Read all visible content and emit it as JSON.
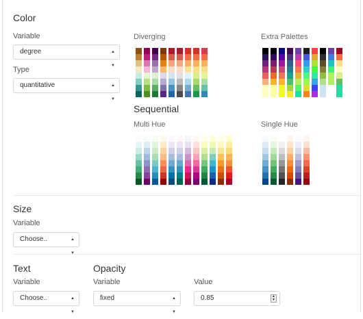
{
  "color": {
    "title": "Color",
    "variable_label": "Variable",
    "variable_value": "degree",
    "type_label": "Type",
    "type_value": "quantitative",
    "diverging_label": "Diverging",
    "extra_label": "Extra Palettes",
    "sequential_label": "Sequential",
    "multi_hue_label": "Multi Hue",
    "single_hue_label": "Single Hue"
  },
  "palettes": {
    "diverging": [
      [
        "#8c510a",
        "#bf812d",
        "#dfc27d",
        "#f6e8c3",
        "#c7eae5",
        "#80cdc1",
        "#35978f",
        "#01665e"
      ],
      [
        "#8e0152",
        "#c51b7d",
        "#de77ae",
        "#f1b6da",
        "#e6f5d0",
        "#b8e186",
        "#7fbc41",
        "#4d9221"
      ],
      [
        "#40004b",
        "#762a83",
        "#9970ab",
        "#c2a5cf",
        "#d9f0d3",
        "#a6dba0",
        "#5aae61",
        "#1b7837"
      ],
      [
        "#7f3b08",
        "#b35806",
        "#e08214",
        "#fdb863",
        "#d8daeb",
        "#b2abd2",
        "#8073ac",
        "#542788"
      ],
      [
        "#b2182b",
        "#d6604d",
        "#f4a582",
        "#fddbc7",
        "#d1e5f0",
        "#92c5de",
        "#4393c3",
        "#2166ac"
      ],
      [
        "#b2182b",
        "#d6604d",
        "#f4a582",
        "#fddbc7",
        "#e0e0e0",
        "#bababa",
        "#878787",
        "#4d4d4d"
      ],
      [
        "#d73027",
        "#f46d43",
        "#fdae61",
        "#fee090",
        "#e0f3f8",
        "#abd9e9",
        "#74add1",
        "#4575b4"
      ],
      [
        "#d73027",
        "#f46d43",
        "#fdae61",
        "#fee08b",
        "#d9ef8b",
        "#a6d96a",
        "#66bd63",
        "#1a9850"
      ],
      [
        "#d53e4f",
        "#f46d43",
        "#fdae61",
        "#fee08b",
        "#e6f598",
        "#abdda4",
        "#66c2a5",
        "#3288bd"
      ]
    ],
    "extra": [
      [
        "#000004",
        "#2c105c",
        "#711f81",
        "#b63679",
        "#ee605e",
        "#fdae78",
        "#fcfdbf",
        "#fcfdbf"
      ],
      [
        "#000004",
        "#320a5e",
        "#781c6d",
        "#bb3754",
        "#ed6925",
        "#fbb61a",
        "#fcffa4",
        "#fcffa4"
      ],
      [
        "#0d0887",
        "#5c01a6",
        "#9c179e",
        "#cc4778",
        "#ed7953",
        "#fdb42f",
        "#f0f921",
        "#f0f921"
      ],
      [
        "#440154",
        "#46327e",
        "#365c8d",
        "#277f8e",
        "#1fa187",
        "#4ac16d",
        "#a0da39",
        "#fde725"
      ],
      [
        "#6e40aa",
        "#bf3caf",
        "#fe4b83",
        "#ff7847",
        "#e2b72f",
        "#aff05b",
        "#52f667",
        "#1ddfa3"
      ],
      [
        "#23171b",
        "#4a58dd",
        "#2f9df5",
        "#27d7c4",
        "#4df884",
        "#95fb51",
        "#dedd32",
        "#ff821d"
      ],
      [
        "#ff4040",
        "#e7a82e",
        "#a8e52e",
        "#40ff40",
        "#2ee7a8",
        "#2ea8e5",
        "#4040ff",
        "#a82ee7"
      ],
      [
        "#000000",
        "#2b2b2b",
        "#5a4e28",
        "#7e7e34",
        "#8fbf3f",
        "#b2df8a",
        "#cfe3f5",
        "#cfe3f5"
      ],
      [
        "#6e40aa",
        "#417de0",
        "#1ac7c2",
        "#40f373",
        "#aff05b",
        "#aff05b",
        "#ffffff",
        "#ffffff"
      ],
      [
        "#a50026",
        "#f46d43",
        "#fee08b",
        "#ffffbf",
        "#d9ef8b",
        "#66bd63",
        "#1ddfa3",
        "#1ddfa3"
      ]
    ],
    "multi_hue": [
      [
        "#f7fcfd",
        "#e5f5f9",
        "#ccece6",
        "#99d8c9",
        "#66c2a4",
        "#41ae76",
        "#238b45",
        "#005824"
      ],
      [
        "#f7fcfd",
        "#e0ecf4",
        "#bfd3e6",
        "#9ebcda",
        "#8c96c6",
        "#8c6bb1",
        "#88419d",
        "#6e016b"
      ],
      [
        "#f7fcf0",
        "#e0f3db",
        "#ccebc5",
        "#a8ddb5",
        "#7bccc4",
        "#4eb3d3",
        "#2b8cbe",
        "#08589e"
      ],
      [
        "#fff7ec",
        "#fee8c8",
        "#fdd49e",
        "#fdbb84",
        "#fc8d59",
        "#ef6548",
        "#d7301f",
        "#990000"
      ],
      [
        "#fff7fb",
        "#ece7f2",
        "#d0d1e6",
        "#a6bddb",
        "#74a9cf",
        "#3690c0",
        "#0570b0",
        "#034e7b"
      ],
      [
        "#fff7fb",
        "#ece2f0",
        "#d0d1e6",
        "#a6bddb",
        "#67a9cf",
        "#3690c0",
        "#02818a",
        "#016450"
      ],
      [
        "#f7f4f9",
        "#e7e1ef",
        "#d4b9da",
        "#c994c7",
        "#df65b0",
        "#e7298a",
        "#ce1256",
        "#91003f"
      ],
      [
        "#fff7f3",
        "#fde0dd",
        "#fcc5c0",
        "#fa9fb5",
        "#f768a1",
        "#dd3497",
        "#ae017e",
        "#7a0177"
      ],
      [
        "#ffffe5",
        "#f7fcb9",
        "#d9f0a3",
        "#addd8e",
        "#78c679",
        "#41ab5d",
        "#238443",
        "#005a32"
      ],
      [
        "#ffffd9",
        "#edf8b1",
        "#c7e9b4",
        "#7fcdbb",
        "#41b6c4",
        "#1d91c0",
        "#225ea8",
        "#0c2c84"
      ],
      [
        "#ffffe5",
        "#fff7bc",
        "#fee391",
        "#fec44f",
        "#fe9929",
        "#ec7014",
        "#cc4c02",
        "#8c2d04"
      ],
      [
        "#ffffcc",
        "#ffeda0",
        "#fed976",
        "#feb24c",
        "#fd8d3c",
        "#fc4e2a",
        "#e31a1c",
        "#b10026"
      ]
    ],
    "single_hue": [
      [
        "#f7fbff",
        "#deebf7",
        "#c6dbef",
        "#9ecae1",
        "#6baed6",
        "#4292c6",
        "#2171b5",
        "#084594"
      ],
      [
        "#f7fcf5",
        "#e5f5e0",
        "#c7e9c0",
        "#a1d99b",
        "#74c476",
        "#41ab5d",
        "#238b45",
        "#005a32"
      ],
      [
        "#ffffff",
        "#f0f0f0",
        "#d9d9d9",
        "#bdbdbd",
        "#969696",
        "#737373",
        "#525252",
        "#252525"
      ],
      [
        "#fff5eb",
        "#fee6ce",
        "#fdd0a2",
        "#fdae6b",
        "#fd8d3c",
        "#f16913",
        "#d94801",
        "#8c2d04"
      ],
      [
        "#fcfbfd",
        "#efedf5",
        "#dadaeb",
        "#bcbddc",
        "#9e9ac8",
        "#807dba",
        "#6a51a3",
        "#4a1486"
      ],
      [
        "#fff5f0",
        "#fee0d2",
        "#fcbba1",
        "#fc9272",
        "#fb6a4a",
        "#ef3b2c",
        "#cb181d",
        "#99000d"
      ]
    ]
  },
  "size": {
    "title": "Size",
    "variable_label": "Variable",
    "variable_value": "Choose.."
  },
  "text": {
    "title": "Text",
    "variable_label": "Variable",
    "variable_value": "Choose.."
  },
  "opacity": {
    "title": "Opacity",
    "variable_label": "Variable",
    "variable_value": "fixed",
    "value_label": "Value",
    "value": "0.85"
  }
}
